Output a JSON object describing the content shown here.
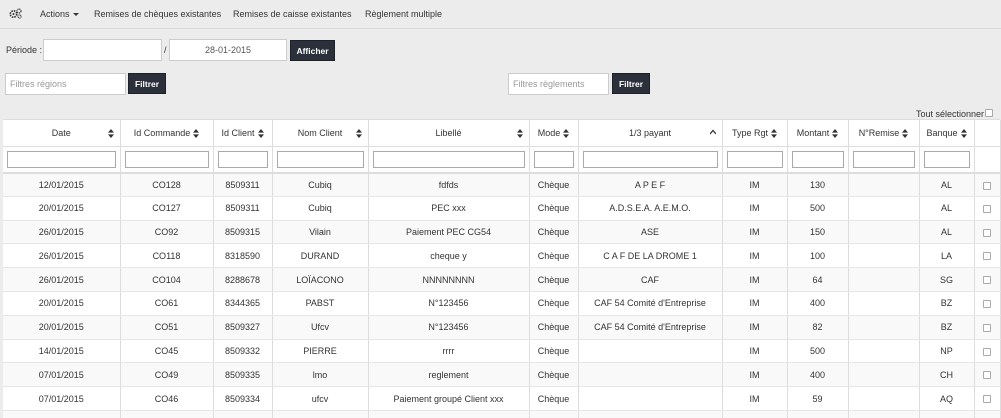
{
  "nav": {
    "actions": "Actions",
    "remises_cheques": "Remises de chèques existantes",
    "remises_caisse": "Remises de caisse existantes",
    "reglement_multiple": "Règlement multiple"
  },
  "periode": {
    "label": "Période :",
    "separator": "/",
    "date_to": "28-01-2015",
    "button": "Afficher"
  },
  "filters": {
    "regions_placeholder": "Filtres régions",
    "regions_button": "Filtrer",
    "reglements_placeholder": "Filtres règlements",
    "reglements_button": "Filtrer"
  },
  "select_all": "Tout sélectionner",
  "table": {
    "headers": [
      "Date",
      "Id Commande",
      "Id Client",
      "Nom Client",
      "Libellé",
      "Mode",
      "1/3 payant",
      "Type Rgt",
      "Montant",
      "N°Remise",
      "Banque"
    ],
    "rows": [
      {
        "date": "12/01/2015",
        "commande": "CO128",
        "client": "8509311",
        "nom": "Cubiq",
        "libelle": "fdfds",
        "mode": "Chèque",
        "tiers": "A P E F",
        "type": "IM",
        "montant": "130",
        "remise": "",
        "banque": "AL"
      },
      {
        "date": "20/01/2015",
        "commande": "CO127",
        "client": "8509311",
        "nom": "Cubiq",
        "libelle": "PEC xxx",
        "mode": "Chèque",
        "tiers": "A.D.S.E.A. A.E.M.O.",
        "type": "IM",
        "montant": "500",
        "remise": "",
        "banque": "AL"
      },
      {
        "date": "26/01/2015",
        "commande": "CO92",
        "client": "8509315",
        "nom": "Vilain",
        "libelle": "Paiement PEC CG54",
        "mode": "Chèque",
        "tiers": "ASE",
        "type": "IM",
        "montant": "150",
        "remise": "",
        "banque": "AL"
      },
      {
        "date": "26/01/2015",
        "commande": "CO118",
        "client": "8318590",
        "nom": "DURAND",
        "libelle": "cheque y",
        "mode": "Chèque",
        "tiers": "C A F DE LA DROME 1",
        "type": "IM",
        "montant": "100",
        "remise": "",
        "banque": "LA"
      },
      {
        "date": "26/01/2015",
        "commande": "CO104",
        "client": "8288678",
        "nom": "LOÏACONO",
        "libelle": "NNNNNNNN",
        "mode": "Chèque",
        "tiers": "CAF",
        "type": "IM",
        "montant": "64",
        "remise": "",
        "banque": "SG"
      },
      {
        "date": "20/01/2015",
        "commande": "CO61",
        "client": "8344365",
        "nom": "PABST",
        "libelle": "N°123456",
        "mode": "Chèque",
        "tiers": "CAF 54 Comité d'Entreprise",
        "type": "IM",
        "montant": "400",
        "remise": "",
        "banque": "BZ"
      },
      {
        "date": "20/01/2015",
        "commande": "CO51",
        "client": "8509327",
        "nom": "Ufcv",
        "libelle": "N°123456",
        "mode": "Chèque",
        "tiers": "CAF 54 Comité d'Entreprise",
        "type": "IM",
        "montant": "82",
        "remise": "",
        "banque": "BZ"
      },
      {
        "date": "14/01/2015",
        "commande": "CO45",
        "client": "8509332",
        "nom": "PIERRE",
        "libelle": "rrrr",
        "mode": "Chèque",
        "tiers": "",
        "type": "IM",
        "montant": "500",
        "remise": "",
        "banque": "NP"
      },
      {
        "date": "07/01/2015",
        "commande": "CO49",
        "client": "8509335",
        "nom": "lmo",
        "libelle": "reglement",
        "mode": "Chèque",
        "tiers": "",
        "type": "IM",
        "montant": "400",
        "remise": "",
        "banque": "CH"
      },
      {
        "date": "07/01/2015",
        "commande": "CO46",
        "client": "8509334",
        "nom": "ufcv",
        "libelle": "Paiement groupé Client xxx",
        "mode": "Chèque",
        "tiers": "",
        "type": "IM",
        "montant": "59",
        "remise": "",
        "banque": "AQ"
      }
    ]
  },
  "colors": {
    "link": "#337ab7",
    "dark_button": "#2b303b"
  }
}
